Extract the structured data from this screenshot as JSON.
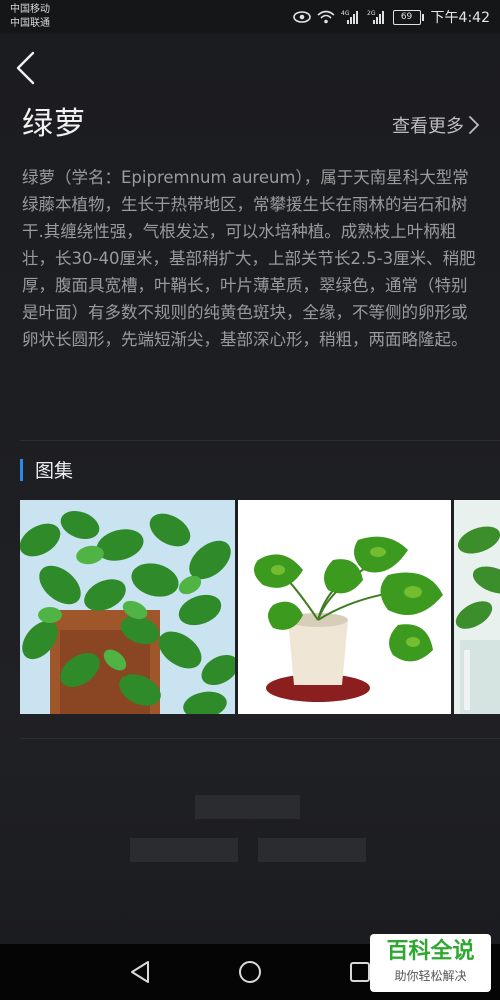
{
  "status_bar": {
    "carrier_1": "中国移动",
    "carrier_2": "中国联通",
    "signal_1": "4G",
    "signal_2": "2G",
    "battery": "69",
    "time": "下午4:42"
  },
  "header": {
    "back_icon": "chevron-left-icon",
    "title": "绿萝",
    "more_link": "查看更多"
  },
  "description": "绿萝（学名：Epipremnum aureum），属于天南星科大型常绿藤本植物，生长于热带地区，常攀援生长在雨林的岩石和树干.其缠绕性强，气根发达，可以水培种植。成熟枝上叶柄粗壮，长30-40厘米，基部稍扩大，上部关节长2.5-3厘米、稍肥厚，腹面具宽槽，叶鞘长，叶片薄革质，翠绿色，通常（特别是叶面）有多数不规则的纯黄色斑块，全缘，不等侧的卵形或卵状长圆形，先端短渐尖，基部深心形，稍粗，两面略隆起。",
  "gallery": {
    "title": "图集",
    "accent_color": "#2a8ae8",
    "images": [
      "pothos-wall-photo",
      "potted-pothos-photo",
      "pothos-in-glass-photo"
    ]
  },
  "nav_bar": {
    "back_icon": "triangle-back-icon",
    "home_icon": "circle-home-icon",
    "recent_icon": "square-recent-icon"
  },
  "watermark": {
    "line_1": "百科全说",
    "line_2": "助你轻松解决",
    "color": "#2fa830"
  }
}
